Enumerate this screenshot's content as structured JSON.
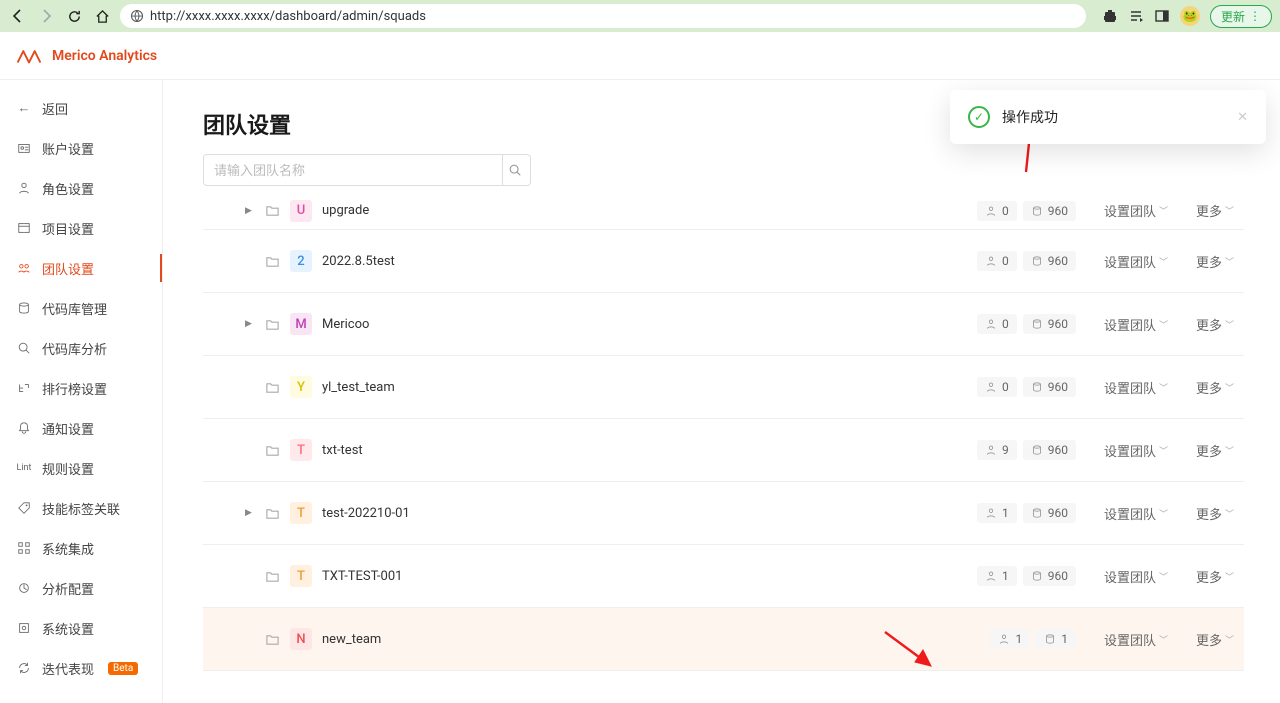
{
  "browser": {
    "url": "http://xxxx.xxxx.xxxx/dashboard/admin/squads",
    "update_label": "更新"
  },
  "brand": {
    "name": "Merico Analytics"
  },
  "toast": {
    "message": "操作成功"
  },
  "sidebar": {
    "items": [
      {
        "label": "返回"
      },
      {
        "label": "账户设置"
      },
      {
        "label": "角色设置"
      },
      {
        "label": "项目设置"
      },
      {
        "label": "团队设置"
      },
      {
        "label": "代码库管理"
      },
      {
        "label": "代码库分析"
      },
      {
        "label": "排行榜设置"
      },
      {
        "label": "通知设置"
      },
      {
        "label": "规则设置"
      },
      {
        "label": "技能标签关联"
      },
      {
        "label": "系统集成"
      },
      {
        "label": "分析配置"
      },
      {
        "label": "系统设置"
      },
      {
        "label": "迭代表现"
      }
    ],
    "beta": "Beta",
    "lint": "Lint"
  },
  "page": {
    "title": "团队设置",
    "search_placeholder": "请输入团队名称",
    "config_label": "设置团队",
    "more_label": "更多"
  },
  "rows": [
    {
      "letter": "U",
      "letterClass": "l-pink",
      "name": "upgrade",
      "expandable": true,
      "members": 0,
      "proj": 960
    },
    {
      "letter": "2",
      "letterClass": "l-blue",
      "name": "2022.8.5test",
      "expandable": false,
      "members": 0,
      "proj": 960
    },
    {
      "letter": "M",
      "letterClass": "l-mag",
      "name": "Mericoo",
      "expandable": true,
      "members": 0,
      "proj": 960
    },
    {
      "letter": "Y",
      "letterClass": "l-yel",
      "name": "yl_test_team",
      "expandable": false,
      "members": 0,
      "proj": 960
    },
    {
      "letter": "T",
      "letterClass": "l-pnk2",
      "name": "txt-test",
      "expandable": false,
      "members": 9,
      "proj": 960
    },
    {
      "letter": "T",
      "letterClass": "l-orn",
      "name": "test-202210-01",
      "expandable": true,
      "members": 1,
      "proj": 960
    },
    {
      "letter": "T",
      "letterClass": "l-orn",
      "name": "TXT-TEST-001",
      "expandable": false,
      "members": 1,
      "proj": 960
    },
    {
      "letter": "N",
      "letterClass": "l-red",
      "name": "new_team",
      "expandable": false,
      "members": 1,
      "proj": 1,
      "highlight": true
    }
  ]
}
